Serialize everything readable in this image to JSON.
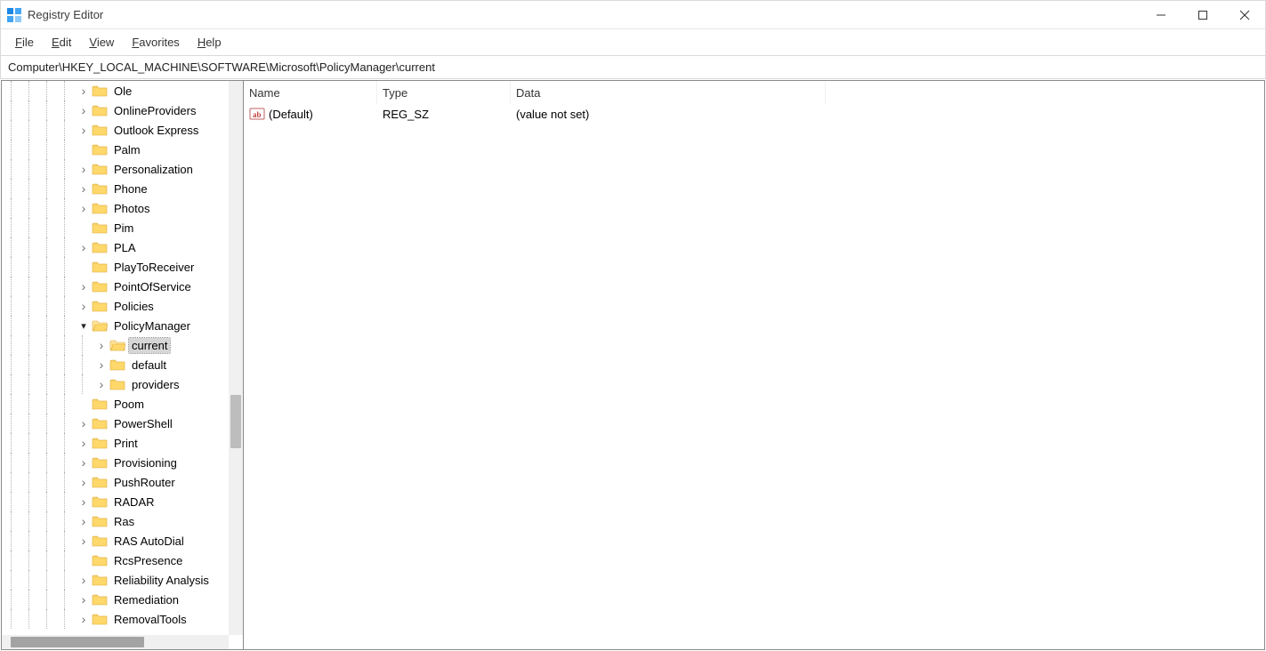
{
  "window": {
    "title": "Registry Editor"
  },
  "menu": {
    "file": "File",
    "edit": "Edit",
    "view": "View",
    "favorites": "Favorites",
    "help": "Help"
  },
  "address": "Computer\\HKEY_LOCAL_MACHINE\\SOFTWARE\\Microsoft\\PolicyManager\\current",
  "list": {
    "headers": {
      "name": "Name",
      "type": "Type",
      "data": "Data"
    },
    "rows": [
      {
        "name": "(Default)",
        "type": "REG_SZ",
        "data": "(value not set)"
      }
    ]
  },
  "tree": {
    "baseIndent": 85,
    "childIndent": 105,
    "nodes": [
      {
        "label": "Ole",
        "exp": "closed"
      },
      {
        "label": "OnlineProviders",
        "exp": "closed"
      },
      {
        "label": "Outlook Express",
        "exp": "closed"
      },
      {
        "label": "Palm",
        "exp": "none"
      },
      {
        "label": "Personalization",
        "exp": "closed"
      },
      {
        "label": "Phone",
        "exp": "closed"
      },
      {
        "label": "Photos",
        "exp": "closed"
      },
      {
        "label": "Pim",
        "exp": "none"
      },
      {
        "label": "PLA",
        "exp": "closed"
      },
      {
        "label": "PlayToReceiver",
        "exp": "none"
      },
      {
        "label": "PointOfService",
        "exp": "closed"
      },
      {
        "label": "Policies",
        "exp": "closed"
      },
      {
        "label": "PolicyManager",
        "exp": "open"
      },
      {
        "label": "current",
        "exp": "closed",
        "child": true,
        "selected": true
      },
      {
        "label": "default",
        "exp": "closed",
        "child": true
      },
      {
        "label": "providers",
        "exp": "closed",
        "child": true
      },
      {
        "label": "Poom",
        "exp": "none"
      },
      {
        "label": "PowerShell",
        "exp": "closed"
      },
      {
        "label": "Print",
        "exp": "closed"
      },
      {
        "label": "Provisioning",
        "exp": "closed"
      },
      {
        "label": "PushRouter",
        "exp": "closed"
      },
      {
        "label": "RADAR",
        "exp": "closed"
      },
      {
        "label": "Ras",
        "exp": "closed"
      },
      {
        "label": "RAS AutoDial",
        "exp": "closed"
      },
      {
        "label": "RcsPresence",
        "exp": "none"
      },
      {
        "label": "Reliability Analysis",
        "exp": "closed"
      },
      {
        "label": "Remediation",
        "exp": "closed"
      },
      {
        "label": "RemovalTools",
        "exp": "closed"
      }
    ]
  }
}
